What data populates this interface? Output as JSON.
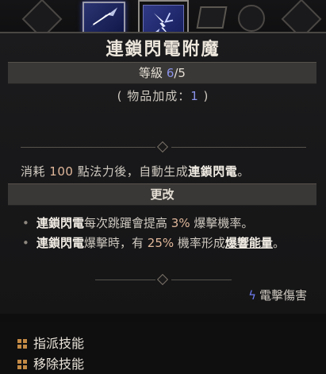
{
  "skill": {
    "title": "連鎖閃電附魔",
    "level_label": "等級 ",
    "level_current": "6",
    "level_max": "/5",
    "bonus_open": "( 物品加成：",
    "bonus_value": "1",
    "bonus_close": " )",
    "description": {
      "part1": "消耗 ",
      "mana": "100",
      "part2": " 點法力後，自動生成",
      "skill": "連鎖閃電",
      "part3": "。"
    },
    "modifier_header": "更改",
    "bullets": [
      {
        "hl": "連鎖閃電",
        "text1": "每次跳躍會提高 ",
        "num": "3%",
        "text2": " 爆擊機率。"
      },
      {
        "hl": "連鎖閃電",
        "text1": "爆擊時，有 ",
        "num": "25%",
        "text2": " 機率形成",
        "link": "爆響能量",
        "text3": "。"
      }
    ],
    "tag": "電擊傷害"
  },
  "actions": {
    "assign": "指派技能",
    "remove": "移除技能"
  },
  "colors": {
    "accent_blue": "#8a92e8",
    "number_orange": "#e0b79a",
    "key_icon": "#c38a45"
  },
  "icons": {
    "selected_skill": "lightning-enchant-icon",
    "neighbor_left": "ice-spear-icon",
    "tag": "lightning-bolt-icon",
    "action_key": "keybind-icon"
  }
}
